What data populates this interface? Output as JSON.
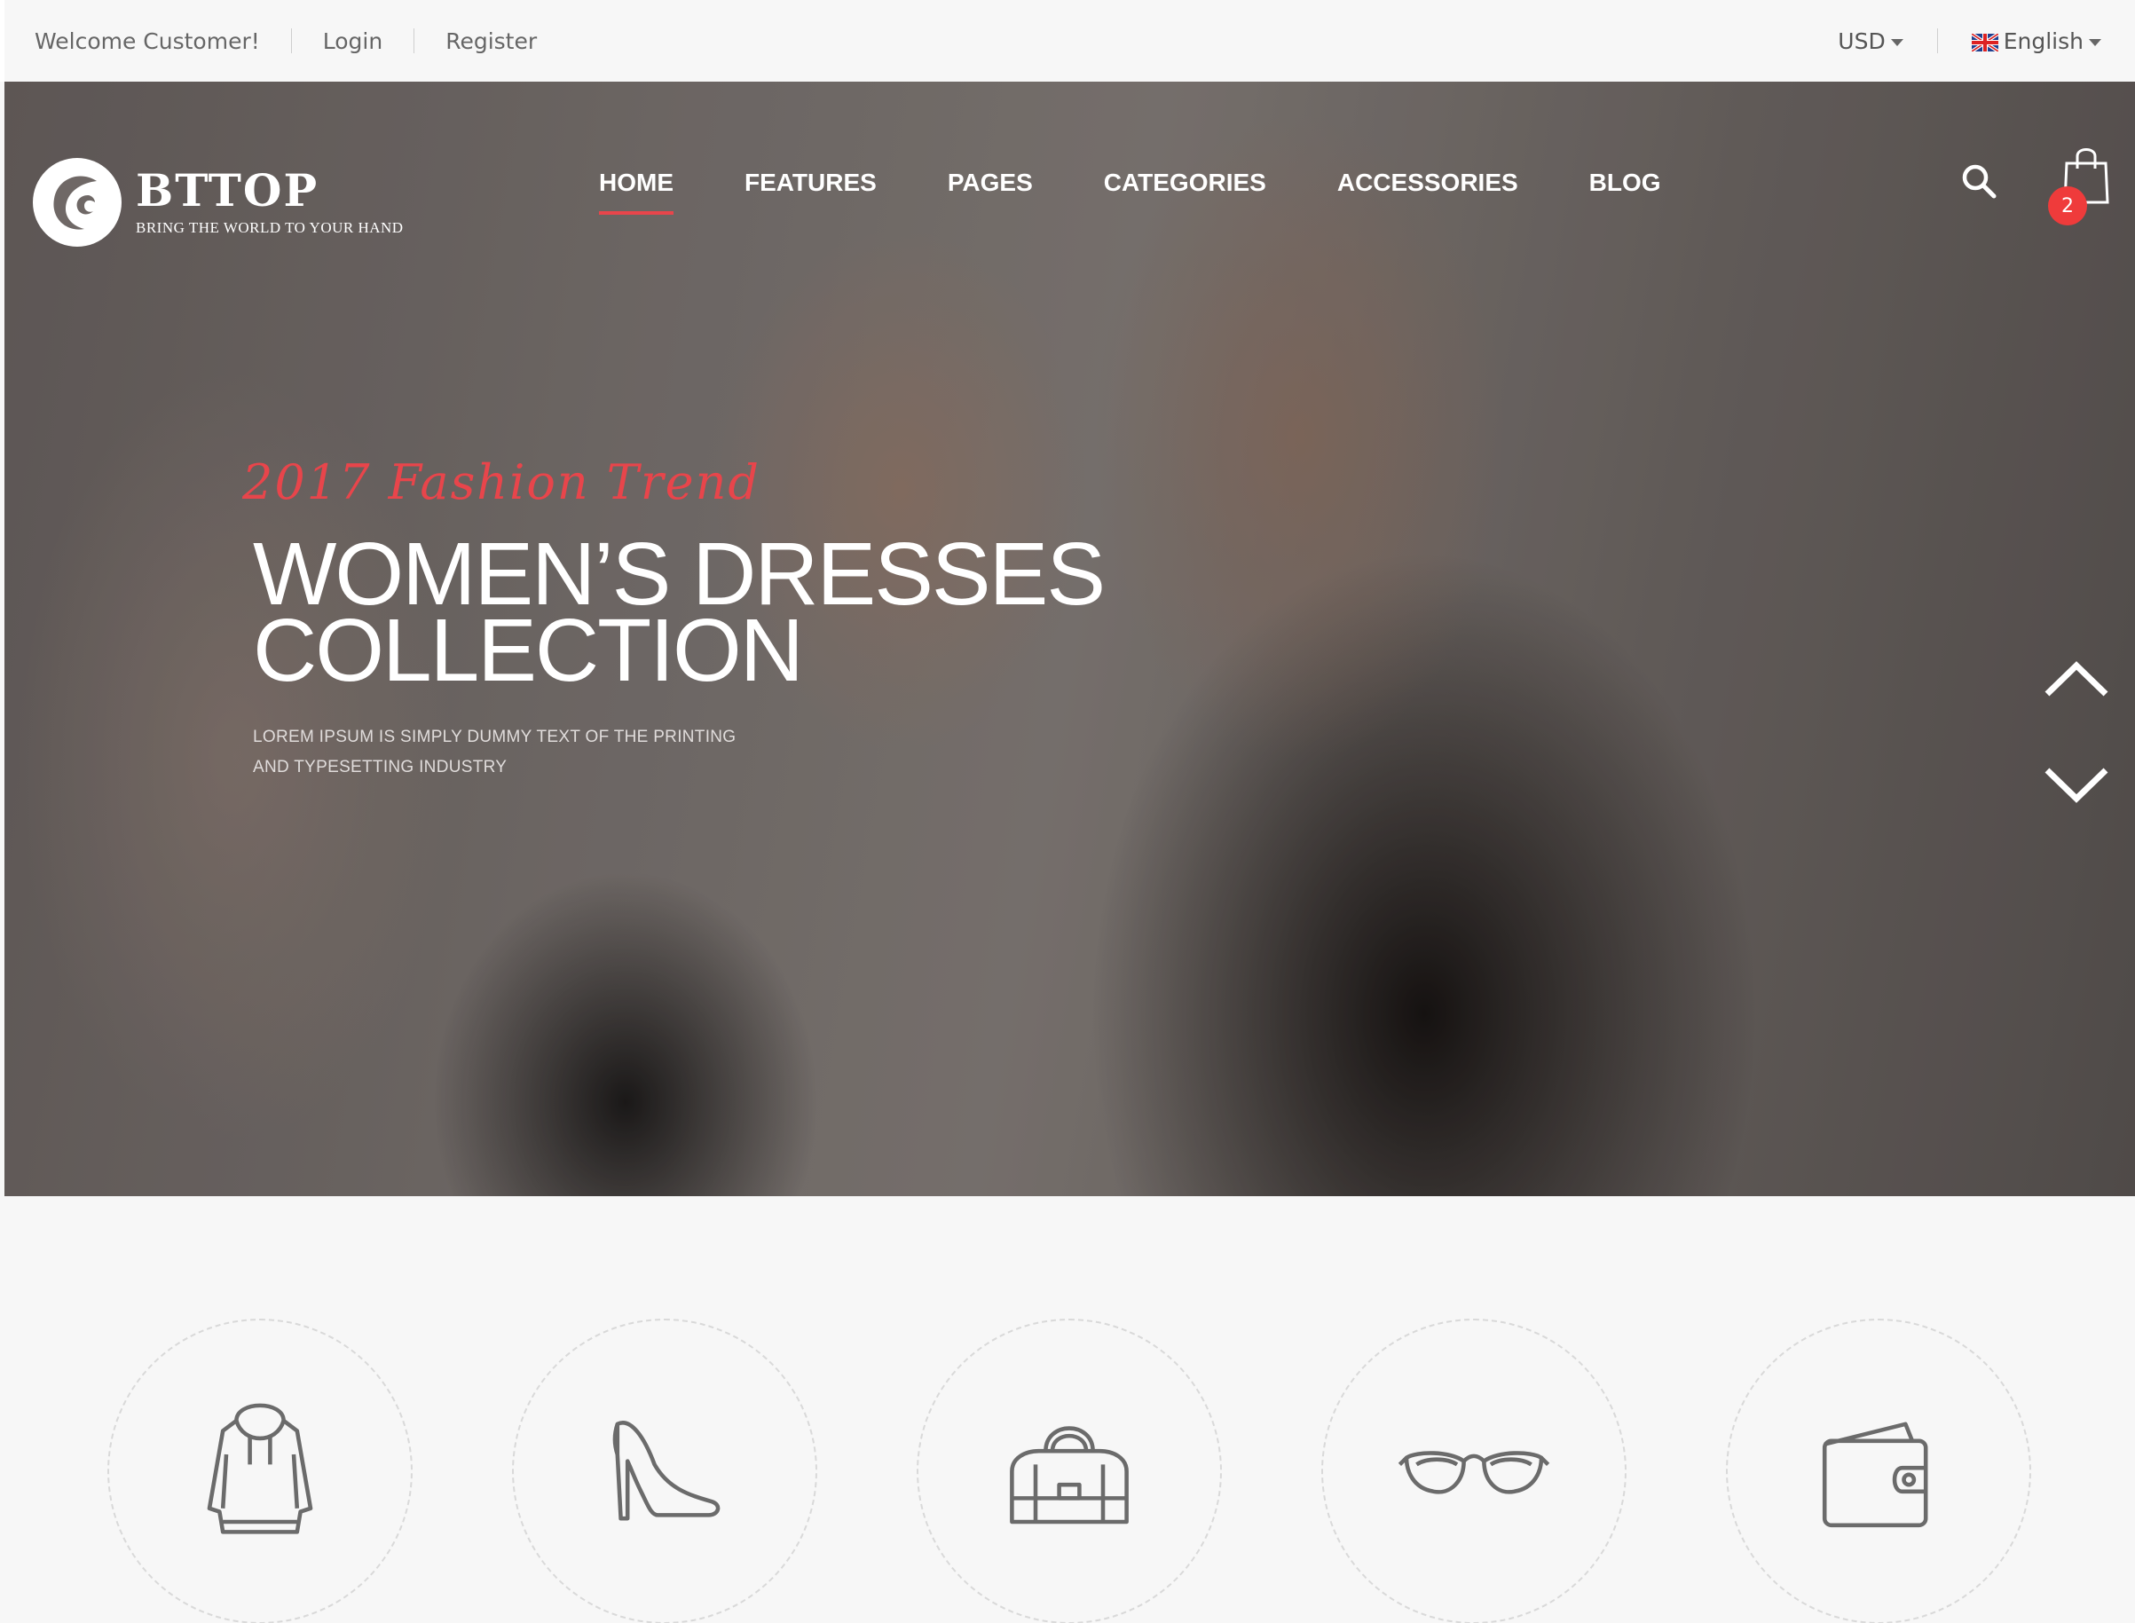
{
  "topbar": {
    "welcome": "Welcome Customer!",
    "login": "Login",
    "register": "Register",
    "currency": "USD",
    "language": "English"
  },
  "logo": {
    "brand": "BTTOP",
    "tagline": "BRING THE WORLD TO YOUR HAND"
  },
  "nav": {
    "items": [
      {
        "label": "HOME",
        "active": true
      },
      {
        "label": "FEATURES"
      },
      {
        "label": "PAGES"
      },
      {
        "label": "CATEGORIES"
      },
      {
        "label": "ACCESSORIES"
      },
      {
        "label": "BLOG"
      }
    ]
  },
  "cart": {
    "count": "2"
  },
  "hero": {
    "script": "2017 Fashion Trend",
    "headline_line1": "WOMEN’S DRESSES",
    "headline_line2": "COLLECTION",
    "sub_line1": "LOREM IPSUM IS SIMPLY DUMMY TEXT OF THE PRINTING",
    "sub_line2": "AND TYPESETTING INDUSTRY"
  },
  "categories": [
    "hoodie-icon",
    "high-heel-icon",
    "handbag-icon",
    "sunglasses-icon",
    "wallet-icon"
  ],
  "colors": {
    "accent": "#e8454b",
    "badge": "#ef3b3b",
    "background": "#f7f7f7"
  }
}
